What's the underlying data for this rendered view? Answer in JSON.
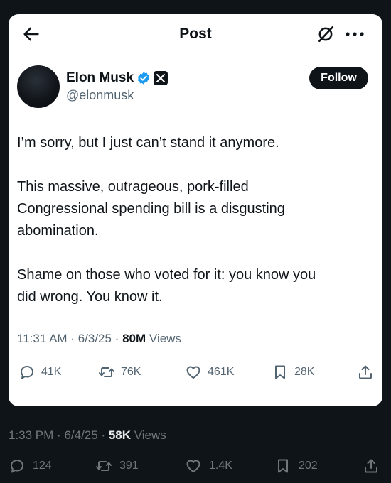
{
  "header": {
    "title": "Post"
  },
  "author": {
    "name": "Elon Musk",
    "handle": "@elonmusk",
    "follow_label": "Follow"
  },
  "tweet": {
    "paragraphs": [
      "I’m sorry, but I just can’t stand it anymore.",
      "This massive, outrageous, pork-filled\nCongressional spending bill is a disgusting\nabomination.",
      "Shame on those who voted for it: you know you\ndid wrong. You know it."
    ],
    "time": "11:31 AM",
    "date": "6/3/25",
    "views_count": "80M",
    "views_label": "Views"
  },
  "actions": {
    "replies": "41K",
    "reposts": "76K",
    "likes": "461K",
    "bookmarks": "28K"
  },
  "outer": {
    "time": "1:33 PM",
    "date": "6/4/25",
    "views_count": "58K",
    "views_label": "Views",
    "replies": "124",
    "reposts": "391",
    "likes": "1.4K",
    "bookmarks": "202"
  },
  "colors": {
    "background": "#0f1419",
    "card": "#ffffff",
    "verified": "#1d9bf0",
    "text": "#0f1419",
    "muted": "#536471"
  }
}
